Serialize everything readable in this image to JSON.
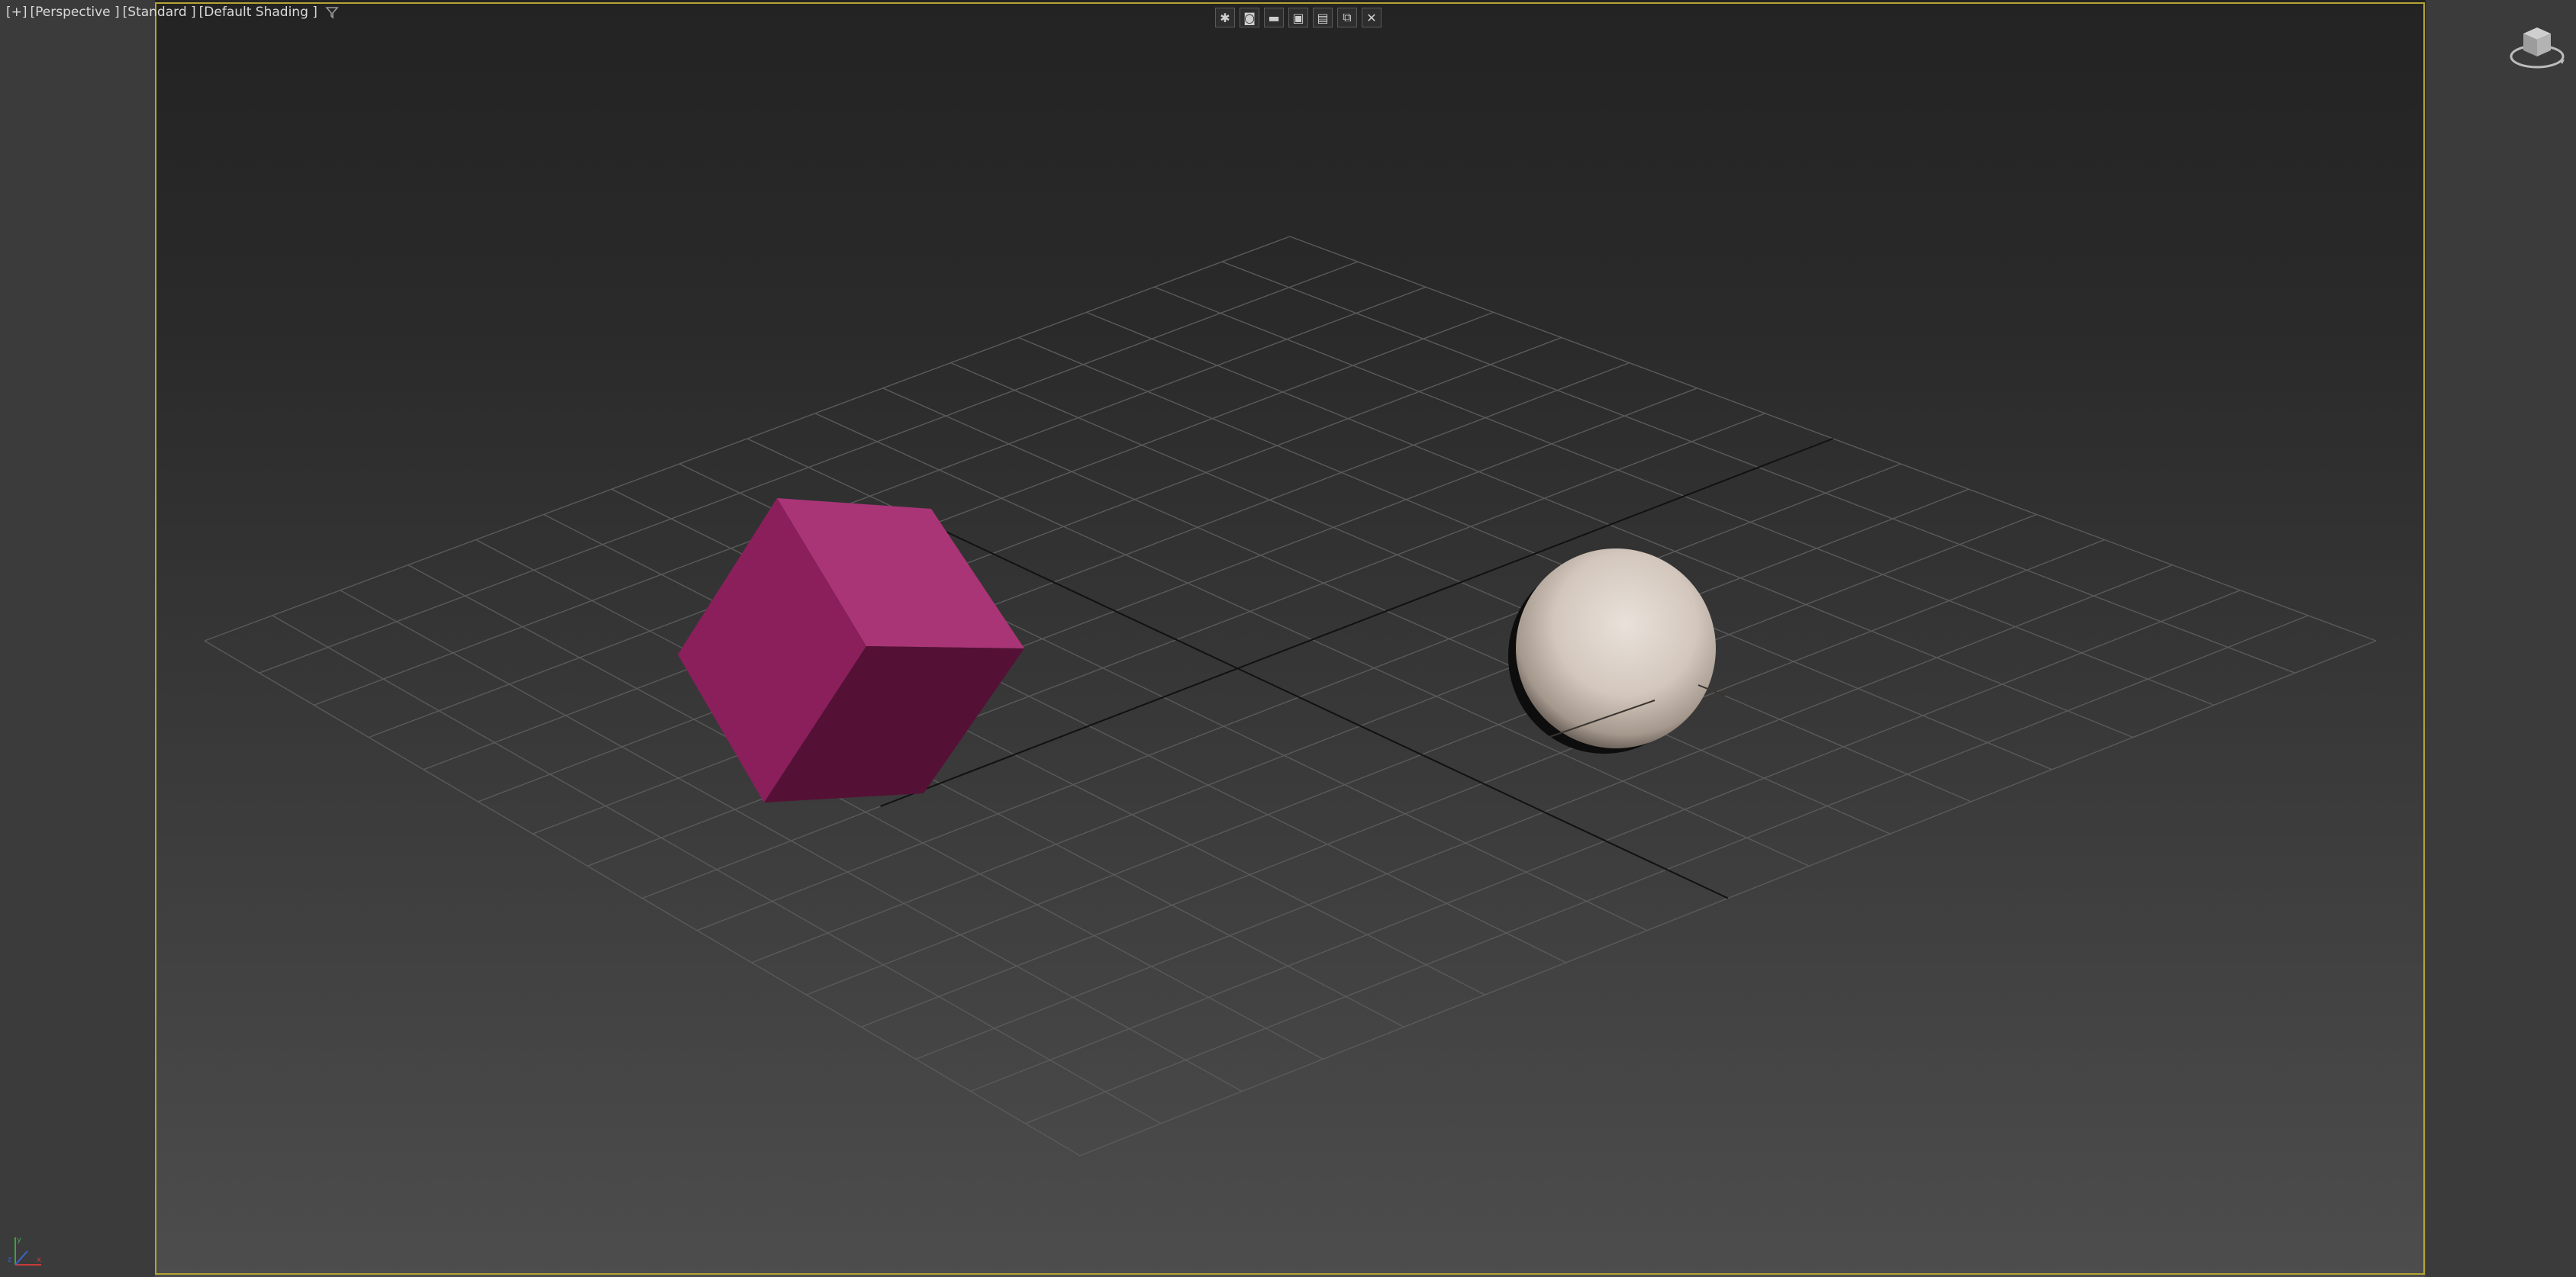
{
  "viewport": {
    "label": {
      "plus": "[+]",
      "view": "[Perspective ]",
      "shading_style": "[Standard ]",
      "shading_mode": "[Default Shading ]"
    },
    "toolbar": [
      {
        "name": "asterisk-icon",
        "glyph": "✱"
      },
      {
        "name": "render-icon",
        "glyph": "◙"
      },
      {
        "name": "safe-frame-icon",
        "glyph": "▬"
      },
      {
        "name": "save-icon",
        "glyph": "▣"
      },
      {
        "name": "display-icon",
        "glyph": "▤"
      },
      {
        "name": "maximize-icon",
        "glyph": "⧉"
      },
      {
        "name": "close-icon",
        "glyph": "✕"
      }
    ],
    "colors": {
      "frame": "#b4a434",
      "box_top": "#a93577",
      "box_left": "#8a1f5c",
      "box_right": "#541135",
      "sphere": "#d8cdc4",
      "grid": "#5a5a5a",
      "grid_axis": "#111111"
    },
    "objects": [
      {
        "name": "box",
        "kind": "cube"
      },
      {
        "name": "sphere",
        "kind": "sphere"
      }
    ]
  }
}
